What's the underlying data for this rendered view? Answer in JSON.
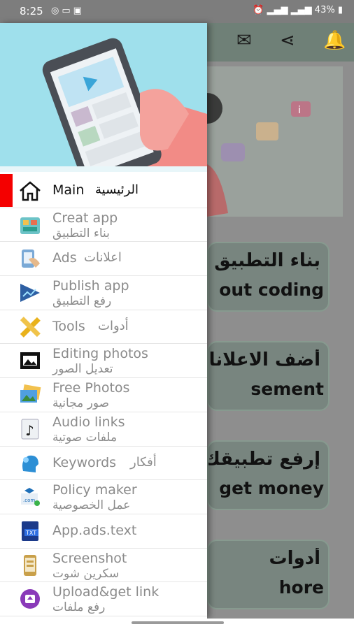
{
  "status_bar": {
    "time": "8:25",
    "battery": "43%",
    "left_icons": [
      "sync-icon",
      "message-icon",
      "image-icon"
    ],
    "right_icons": [
      "alarm-icon",
      "signal-icon",
      "signal-icon",
      "signal-icon",
      "signal-icon",
      "battery-icon"
    ]
  },
  "toolbar": {
    "icons": [
      "mail-icon",
      "share-icon",
      "bell-icon"
    ]
  },
  "background_cards": [
    {
      "line1": "بناء التطبيق",
      "line2": "out coding"
    },
    {
      "line1": "أضف الاعلانات",
      "line2": "sement"
    },
    {
      "line1": "إرفع تطبيقك",
      "line2": "get money"
    },
    {
      "line1": "أدوات",
      "line2": "hore"
    }
  ],
  "drawer": {
    "items": [
      {
        "en": "Main",
        "ar": "الرئيسية",
        "icon": "home-icon",
        "active": true
      },
      {
        "en": "Creat app",
        "ar": "بناء التطبيق",
        "icon": "app-builder-icon"
      },
      {
        "en": "Ads",
        "ar": "اعلانات",
        "icon": "ads-icon"
      },
      {
        "en": "Publish app",
        "ar": "رفع التطبيق",
        "icon": "publish-icon"
      },
      {
        "en": "Tools",
        "ar": "أدوات",
        "icon": "tools-icon"
      },
      {
        "en": "Editing photos",
        "ar": "تعديل الصور",
        "icon": "photo-edit-icon"
      },
      {
        "en": "Free Photos",
        "ar": "صور مجانية",
        "icon": "photos-icon"
      },
      {
        "en": "Audio links",
        "ar": "ملفات صوتية",
        "icon": "audio-icon"
      },
      {
        "en": "Keywords",
        "ar": "أفكار",
        "icon": "keywords-icon"
      },
      {
        "en": "Policy maker",
        "ar": "عمل الخصوصية",
        "icon": "policy-icon"
      },
      {
        "en": "App.ads.text",
        "ar": "",
        "icon": "txt-file-icon"
      },
      {
        "en": "Screenshot",
        "ar": "سكرين شوت",
        "icon": "screenshot-icon"
      },
      {
        "en": "Upload&get link",
        "ar": "رفع ملفات",
        "icon": "upload-icon"
      }
    ]
  },
  "colors": {
    "active_bar": "#f40000",
    "header_bg": "#9fe0ec",
    "card_bg": "#78857f",
    "scrim": "#8e8e8e"
  }
}
